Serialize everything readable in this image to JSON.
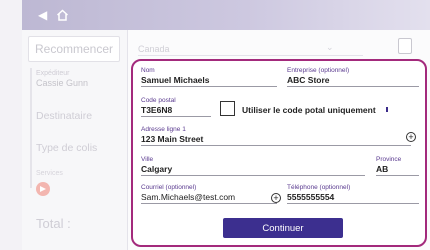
{
  "sidebar": {
    "restart_label": "Recommencer",
    "sender_heading": "Expéditeur",
    "sender_name": "Cassie Gunn",
    "recipient_label": "Destinataire",
    "package_type_label": "Type de colis",
    "services_label": "Services",
    "total_label": "Total :"
  },
  "main": {
    "country_value": "Canada"
  },
  "form": {
    "name_label": "Nom",
    "name_value": "Samuel Michaels",
    "company_label": "Entreprise (optionnel)",
    "company_value": "ABC Store",
    "postal_label": "Code postal",
    "postal_value": "T3E6N8",
    "postal_only_label": "Utiliser le code potal uniquement",
    "address1_label": "Adresse ligne 1",
    "address1_value": "123 Main Street",
    "city_label": "Ville",
    "city_value": "Calgary",
    "province_label": "Province",
    "province_value": "AB",
    "email_label": "Courriel (optionnel)",
    "email_value": "Sam.Michaels@test.com",
    "phone_label": "Téléphone (optionnel)",
    "phone_value": "5555555554",
    "continue_label": "Continuer"
  },
  "colors": {
    "accent": "#3c2f8f",
    "highlight_border": "#a32a7c",
    "topbar": "#c9c4dc"
  }
}
